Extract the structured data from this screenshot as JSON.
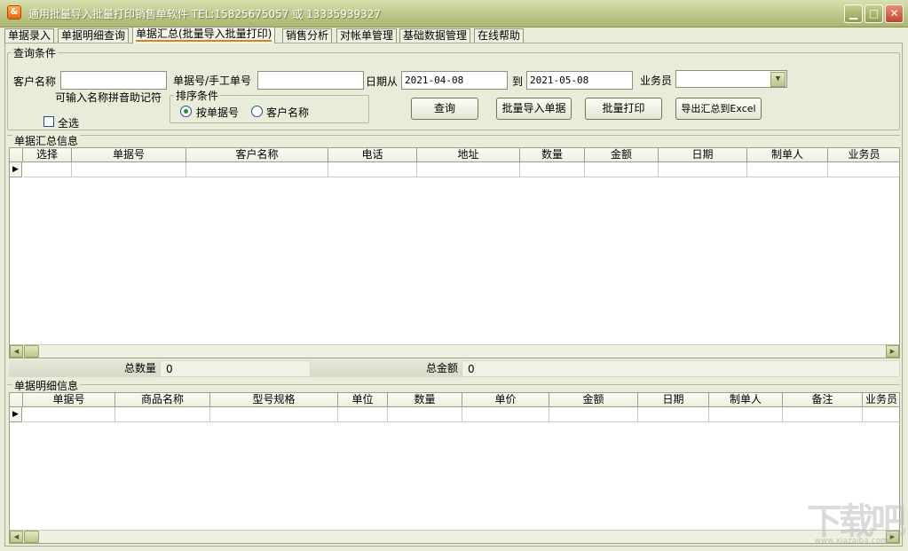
{
  "window": {
    "title": "通用批量导入批量打印销售单软件 TEL:15825675057 或 13335939327",
    "app_icon_glyph": "&",
    "minimize_glyph": "▁",
    "maximize_glyph": "□",
    "close_glyph": "✕"
  },
  "tabs": [
    "单据录入",
    "单据明细查询",
    "单据汇总(批量导入批量打印)",
    "销售分析",
    "对帐单管理",
    "基础数据管理",
    "在线帮助"
  ],
  "query": {
    "legend": "查询条件",
    "customer_label": "客户名称",
    "customer_value": "",
    "customer_hint": "可输入名称拼音助记符",
    "select_all_label": "全选",
    "doc_no_label": "单据号/手工单号",
    "doc_no_value": "",
    "date_from_label": "日期从",
    "date_from_value": "2021-04-08",
    "date_to_label": "到",
    "date_to_value": "2021-05-08",
    "salesman_label": "业务员",
    "salesman_value": "",
    "sort_legend": "排序条件",
    "sort_by_doc_label": "按单据号",
    "sort_by_customer_label": "客户名称",
    "buttons": {
      "query": "查询",
      "batch_import": "批量导入单据",
      "batch_print": "批量打印",
      "export_excel": "导出汇总到Excel"
    }
  },
  "summary": {
    "title": "单据汇总信息",
    "columns": [
      "选择",
      "单据号",
      "客户名称",
      "电话",
      "地址",
      "数量",
      "金额",
      "日期",
      "制单人",
      "业务员"
    ],
    "row_indicator": "▶",
    "total_qty_label": "总数量",
    "total_qty_value": "0",
    "total_amount_label": "总金额",
    "total_amount_value": "0"
  },
  "detail": {
    "title": "单据明细信息",
    "columns": [
      "单据号",
      "商品名称",
      "型号规格",
      "单位",
      "数量",
      "单价",
      "金额",
      "日期",
      "制单人",
      "备注",
      "业务员"
    ],
    "row_indicator": "▶"
  },
  "scroll": {
    "left_glyph": "◀",
    "right_glyph": "▶"
  },
  "watermark": {
    "text": "下载吧",
    "subtext": "www.xiazaiba.com"
  }
}
